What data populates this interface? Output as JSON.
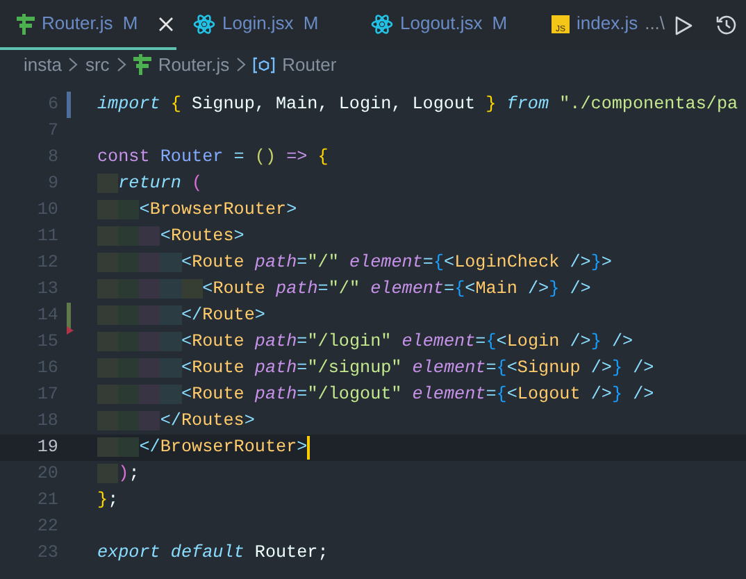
{
  "tabs": [
    {
      "label": "Router.js",
      "kind": "router",
      "badge": "M",
      "selected": true
    },
    {
      "label": "Login.jsx",
      "kind": "react",
      "badge": "M",
      "selected": false
    },
    {
      "label": "Logout.jsx",
      "kind": "react",
      "badge": "M",
      "selected": false
    },
    {
      "label": "index.js",
      "kind": "js",
      "icon_text": "JS",
      "description": "...\\",
      "selected": false
    }
  ],
  "breadcrumb": [
    {
      "label": "insta"
    },
    {
      "label": "src"
    },
    {
      "label": "Router.js",
      "kind": "router"
    },
    {
      "label": "Router",
      "kind": "symbol"
    }
  ],
  "lines": [
    {
      "number": "6",
      "kind": "modified",
      "current": false,
      "tokens": [
        {
          "text": "import",
          "kind": "ctrl"
        },
        {
          "text": " {",
          "kind": "b1"
        },
        {
          "text": " Signup, Main, Login, Logout",
          "kind": "plain"
        },
        {
          "text": " }",
          "kind": "b1"
        },
        {
          "text": " from",
          "kind": "ctrl"
        },
        {
          "text": " \"./componentas/pa",
          "kind": "str"
        }
      ]
    },
    {
      "number": "7",
      "kind": "plain",
      "current": false
    },
    {
      "number": "8",
      "kind": "plain",
      "current": false,
      "tokens": [
        {
          "text": "const",
          "kind": "kw"
        },
        {
          "text": " Router",
          "kind": "fn"
        },
        {
          "text": " =",
          "kind": "punct"
        },
        {
          "text": " ()",
          "kind": "b0"
        },
        {
          "text": " =>",
          "kind": "kw"
        },
        {
          "text": " {",
          "kind": "b1"
        }
      ]
    },
    {
      "number": "9",
      "kind": "plain",
      "current": false,
      "tokens": [
        {
          "text": "  return",
          "kind": "ctrl"
        },
        {
          "text": " (",
          "kind": "b2"
        }
      ]
    },
    {
      "number": "10",
      "kind": "plain",
      "current": false,
      "tokens": [
        {
          "text": "    <",
          "kind": "punct"
        },
        {
          "text": "BrowserRouter",
          "kind": "tag"
        },
        {
          "text": ">",
          "kind": "punct"
        }
      ]
    },
    {
      "number": "11",
      "kind": "plain",
      "current": false,
      "tokens": [
        {
          "text": "      <",
          "kind": "punct"
        },
        {
          "text": "Routes",
          "kind": "tag"
        },
        {
          "text": ">",
          "kind": "punct"
        }
      ]
    },
    {
      "number": "12",
      "kind": "plain",
      "current": false,
      "tokens": [
        {
          "text": "        <",
          "kind": "punct"
        },
        {
          "text": "Route",
          "kind": "tag"
        },
        {
          "text": " path",
          "kind": "attr"
        },
        {
          "text": "=",
          "kind": "punct"
        },
        {
          "text": "\"/\"",
          "kind": "str"
        },
        {
          "text": " element",
          "kind": "attr"
        },
        {
          "text": "=",
          "kind": "punct"
        },
        {
          "text": "{",
          "kind": "b3"
        },
        {
          "text": "<",
          "kind": "punct"
        },
        {
          "text": "LoginCheck",
          "kind": "tag"
        },
        {
          "text": " />",
          "kind": "punct"
        },
        {
          "text": "}",
          "kind": "b3"
        },
        {
          "text": ">",
          "kind": "punct"
        }
      ]
    },
    {
      "number": "13",
      "kind": "plain",
      "current": false,
      "tokens": [
        {
          "text": "          <",
          "kind": "punct"
        },
        {
          "text": "Route",
          "kind": "tag"
        },
        {
          "text": " path",
          "kind": "attr"
        },
        {
          "text": "=",
          "kind": "punct"
        },
        {
          "text": "\"/\"",
          "kind": "str"
        },
        {
          "text": " element",
          "kind": "attr"
        },
        {
          "text": "=",
          "kind": "punct"
        },
        {
          "text": "{",
          "kind": "b3"
        },
        {
          "text": "<",
          "kind": "punct"
        },
        {
          "text": "Main",
          "kind": "tag"
        },
        {
          "text": " />",
          "kind": "punct"
        },
        {
          "text": "}",
          "kind": "b3"
        },
        {
          "text": " />",
          "kind": "punct"
        }
      ]
    },
    {
      "number": "14",
      "kind": "added",
      "current": false,
      "tokens": [
        {
          "text": "        </",
          "kind": "punct"
        },
        {
          "text": "Route",
          "kind": "tag"
        },
        {
          "text": ">",
          "kind": "punct"
        }
      ]
    },
    {
      "number": "15",
      "kind": "deleted",
      "current": false,
      "tokens": [
        {
          "text": "        <",
          "kind": "punct"
        },
        {
          "text": "Route",
          "kind": "tag"
        },
        {
          "text": " path",
          "kind": "attr"
        },
        {
          "text": "=",
          "kind": "punct"
        },
        {
          "text": "\"/login\"",
          "kind": "str"
        },
        {
          "text": " element",
          "kind": "attr"
        },
        {
          "text": "=",
          "kind": "punct"
        },
        {
          "text": "{",
          "kind": "b3"
        },
        {
          "text": "<",
          "kind": "punct"
        },
        {
          "text": "Login",
          "kind": "tag"
        },
        {
          "text": " />",
          "kind": "punct"
        },
        {
          "text": "}",
          "kind": "b3"
        },
        {
          "text": " />",
          "kind": "punct"
        }
      ]
    },
    {
      "number": "16",
      "kind": "plain",
      "current": false,
      "tokens": [
        {
          "text": "        <",
          "kind": "punct"
        },
        {
          "text": "Route",
          "kind": "tag"
        },
        {
          "text": " path",
          "kind": "attr"
        },
        {
          "text": "=",
          "kind": "punct"
        },
        {
          "text": "\"/signup\"",
          "kind": "str"
        },
        {
          "text": " element",
          "kind": "attr"
        },
        {
          "text": "=",
          "kind": "punct"
        },
        {
          "text": "{",
          "kind": "b3"
        },
        {
          "text": "<",
          "kind": "punct"
        },
        {
          "text": "Signup",
          "kind": "tag"
        },
        {
          "text": " />",
          "kind": "punct"
        },
        {
          "text": "}",
          "kind": "b3"
        },
        {
          "text": " />",
          "kind": "punct"
        }
      ]
    },
    {
      "number": "17",
      "kind": "plain",
      "current": false,
      "tokens": [
        {
          "text": "        <",
          "kind": "punct"
        },
        {
          "text": "Route",
          "kind": "tag"
        },
        {
          "text": " path",
          "kind": "attr"
        },
        {
          "text": "=",
          "kind": "punct"
        },
        {
          "text": "\"/logout\"",
          "kind": "str"
        },
        {
          "text": " element",
          "kind": "attr"
        },
        {
          "text": "=",
          "kind": "punct"
        },
        {
          "text": "{",
          "kind": "b3"
        },
        {
          "text": "<",
          "kind": "punct"
        },
        {
          "text": "Logout",
          "kind": "tag"
        },
        {
          "text": " />",
          "kind": "punct"
        },
        {
          "text": "}",
          "kind": "b3"
        },
        {
          "text": " />",
          "kind": "punct"
        }
      ]
    },
    {
      "number": "18",
      "kind": "plain",
      "current": false,
      "tokens": [
        {
          "text": "      </",
          "kind": "punct"
        },
        {
          "text": "Routes",
          "kind": "tag"
        },
        {
          "text": ">",
          "kind": "punct"
        }
      ]
    },
    {
      "number": "19",
      "kind": "plain",
      "current": true,
      "tokens": [
        {
          "text": "    </",
          "kind": "punct"
        },
        {
          "text": "BrowserRouter",
          "kind": "tag"
        },
        {
          "text": ">",
          "kind": "punct"
        }
      ]
    },
    {
      "number": "20",
      "kind": "plain",
      "current": false,
      "tokens": [
        {
          "text": "  )",
          "kind": "b2"
        },
        {
          "text": ";",
          "kind": "plain"
        }
      ]
    },
    {
      "number": "21",
      "kind": "plain",
      "current": false,
      "tokens": [
        {
          "text": "}",
          "kind": "b1"
        },
        {
          "text": ";",
          "kind": "plain"
        }
      ]
    },
    {
      "number": "22",
      "kind": "plain",
      "current": false
    },
    {
      "number": "23",
      "kind": "plain",
      "current": false,
      "tokens": [
        {
          "text": "export",
          "kind": "ctrl"
        },
        {
          "text": " default",
          "kind": "ctrl"
        },
        {
          "text": " Router;",
          "kind": "plain"
        }
      ]
    }
  ]
}
